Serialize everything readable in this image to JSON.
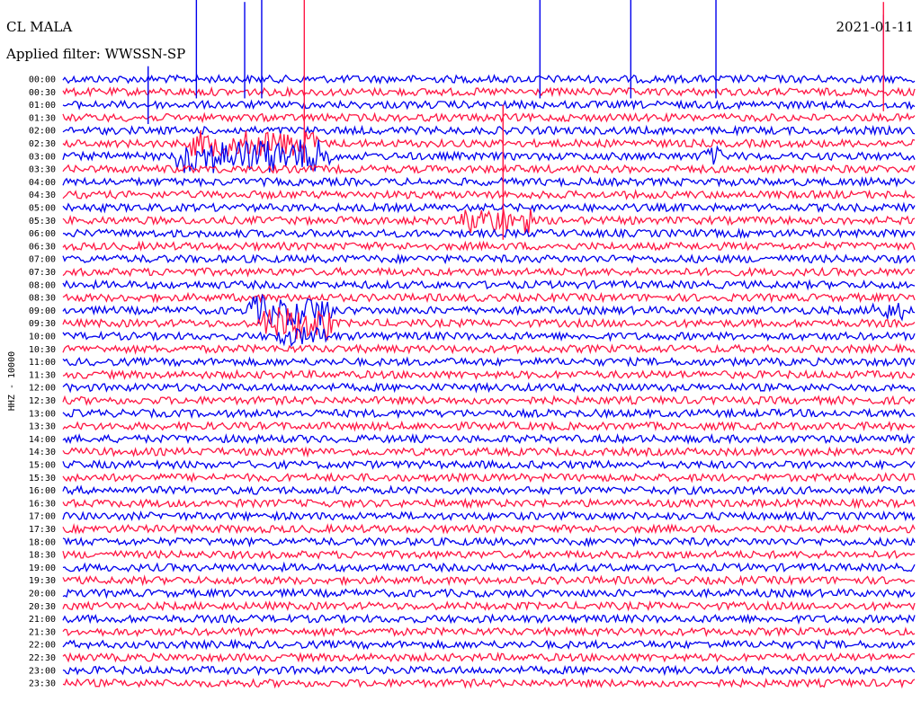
{
  "header": {
    "station": "CL MALA",
    "date": "2021-01-11",
    "filter_text": "Applied filter: WWSSN-SP"
  },
  "chart_data": {
    "type": "line",
    "channel_label": "HHZ - 10000",
    "colors": [
      "#0000ee",
      "#ff1744"
    ],
    "grid": false,
    "x_range_minutes": [
      0,
      30
    ],
    "rows": [
      "00:00",
      "00:30",
      "01:00",
      "01:30",
      "02:00",
      "02:30",
      "03:00",
      "03:30",
      "04:00",
      "04:30",
      "05:00",
      "05:30",
      "06:00",
      "06:30",
      "07:00",
      "07:30",
      "08:00",
      "08:30",
      "09:00",
      "09:30",
      "10:00",
      "10:30",
      "11:00",
      "11:30",
      "12:00",
      "12:30",
      "13:00",
      "13:30",
      "14:00",
      "14:30",
      "15:00",
      "15:30",
      "16:00",
      "16:30",
      "17:00",
      "17:30",
      "18:00",
      "18:30",
      "19:00",
      "19:30",
      "20:00",
      "20:30",
      "21:00",
      "21:30",
      "22:00",
      "22:30",
      "23:00",
      "23:30"
    ],
    "events": [
      {
        "row": "02:30",
        "start_min": 4.5,
        "end_min": 9.0,
        "amplitude": 3.5
      },
      {
        "row": "03:00",
        "start_min": 4.0,
        "end_min": 9.5,
        "amplitude": 4.5
      },
      {
        "row": "05:30",
        "start_min": 14.0,
        "end_min": 16.5,
        "amplitude": 3.5
      },
      {
        "row": "09:00",
        "start_min": 6.5,
        "end_min": 9.5,
        "amplitude": 4.0
      },
      {
        "row": "09:30",
        "start_min": 7.0,
        "end_min": 9.5,
        "amplitude": 4.5
      },
      {
        "row": "10:00",
        "start_min": 7.5,
        "end_min": 9.3,
        "amplitude": 2.5
      },
      {
        "row": "09:00",
        "start_min": 28.5,
        "end_min": 29.6,
        "amplitude": 2.5
      },
      {
        "row": "03:00",
        "start_min": 22.5,
        "end_min": 23.2,
        "amplitude": 2.5
      }
    ],
    "spikes": [
      {
        "row": "00:00",
        "at_min": 4.7,
        "height": 14
      },
      {
        "row": "00:00",
        "at_min": 6.4,
        "height": 12
      },
      {
        "row": "00:00",
        "at_min": 7.0,
        "height": 15
      },
      {
        "row": "01:00",
        "at_min": 3.0,
        "height": 6
      },
      {
        "row": "02:30",
        "at_min": 8.5,
        "height": 40
      },
      {
        "row": "05:30",
        "at_min": 15.5,
        "height": 18
      },
      {
        "row": "00:00",
        "at_min": 16.8,
        "height": 18
      },
      {
        "row": "00:00",
        "at_min": 20.0,
        "height": 16
      },
      {
        "row": "00:00",
        "at_min": 23.0,
        "height": 20
      },
      {
        "row": "00:00",
        "at_min": 28.9,
        "height": 10
      },
      {
        "row": "00:30",
        "at_min": 28.9,
        "height": 14
      }
    ]
  }
}
